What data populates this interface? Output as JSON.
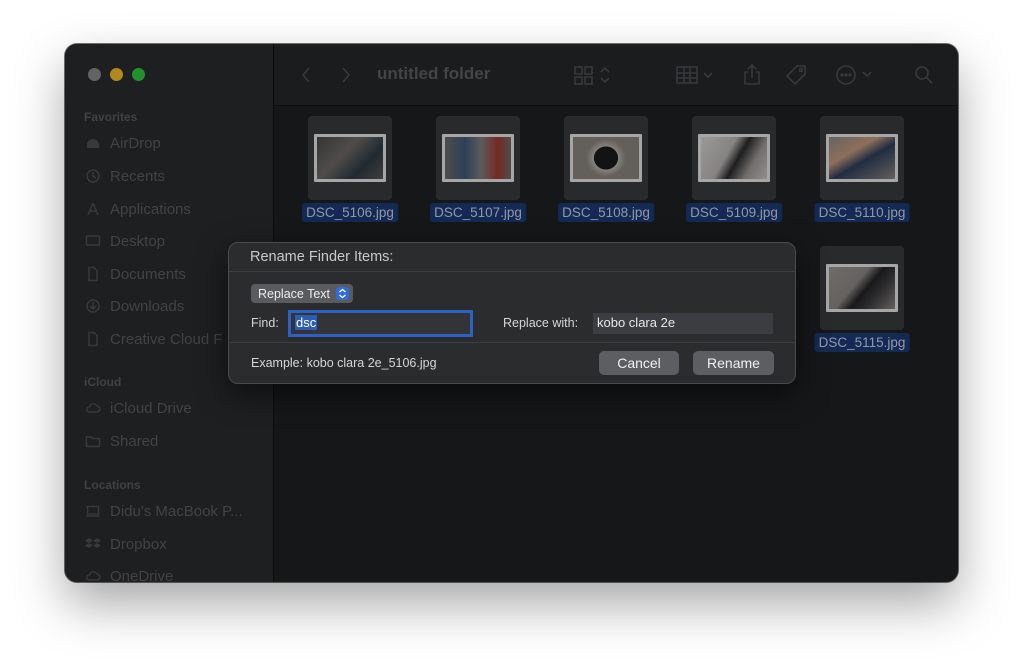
{
  "window": {
    "title": "untitled folder"
  },
  "sidebar": {
    "sections": [
      {
        "title": "Favorites",
        "items": [
          {
            "label": "AirDrop",
            "icon": "airdrop-icon"
          },
          {
            "label": "Recents",
            "icon": "clock-icon"
          },
          {
            "label": "Applications",
            "icon": "applications-icon"
          },
          {
            "label": "Desktop",
            "icon": "desktop-icon"
          },
          {
            "label": "Documents",
            "icon": "document-icon"
          },
          {
            "label": "Downloads",
            "icon": "download-icon"
          },
          {
            "label": "Creative Cloud F",
            "icon": "file-icon"
          }
        ]
      },
      {
        "title": "iCloud",
        "items": [
          {
            "label": "iCloud Drive",
            "icon": "cloud-icon"
          },
          {
            "label": "Shared",
            "icon": "shared-folder-icon"
          }
        ]
      },
      {
        "title": "Locations",
        "items": [
          {
            "label": "Didu's MacBook P...",
            "icon": "laptop-icon"
          },
          {
            "label": "Dropbox",
            "icon": "dropbox-icon"
          },
          {
            "label": "OneDrive",
            "icon": "cloud-icon"
          }
        ]
      }
    ]
  },
  "files": [
    {
      "name": "DSC_5106.jpg"
    },
    {
      "name": "DSC_5107.jpg"
    },
    {
      "name": "DSC_5108.jpg"
    },
    {
      "name": "DSC_5109.jpg"
    },
    {
      "name": "DSC_5110.jpg"
    },
    {
      "name": "DSC_5115.jpg"
    }
  ],
  "dialog": {
    "title": "Rename Finder Items:",
    "mode": "Replace Text",
    "find_label": "Find:",
    "find_value": "dsc",
    "replace_label": "Replace with:",
    "replace_value": "kobo clara 2e",
    "example": "Example: kobo clara 2e_5106.jpg",
    "cancel_label": "Cancel",
    "rename_label": "Rename"
  },
  "colors": {
    "accent": "#2b62c4",
    "selection": "#1d3a73",
    "window_bg": "#1f2022"
  }
}
